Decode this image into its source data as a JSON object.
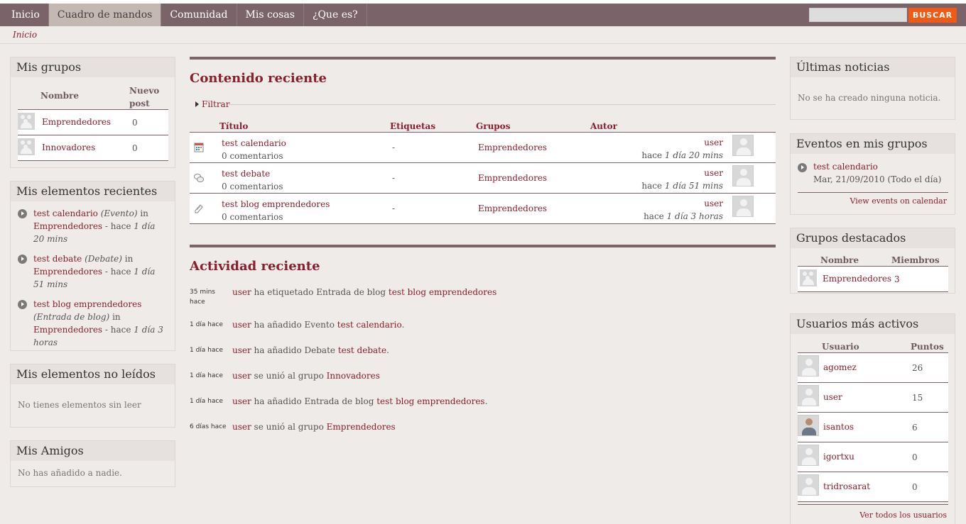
{
  "nav": {
    "tabs": [
      "Inicio",
      "Cuadro de mandos",
      "Comunidad",
      "Mis cosas",
      "¿Que es?"
    ],
    "active_index": 1,
    "search_placeholder": "",
    "search_button": "BUSCAR"
  },
  "breadcrumb": "Inicio",
  "left": {
    "groups": {
      "title": "Mis grupos",
      "col_name": "Nombre",
      "col_new": "Nuevo post",
      "rows": [
        {
          "name": "Emprendedores",
          "count": "0"
        },
        {
          "name": "Innovadores",
          "count": "0"
        }
      ]
    },
    "recent": {
      "title": "Mis elementos recientes",
      "items": [
        {
          "title": "test calendario",
          "type": "(Evento)",
          "in": " in ",
          "group": "Emprendedores",
          "sep": " - hace ",
          "time": "1 día 20 mins"
        },
        {
          "title": "test debate",
          "type": "(Debate)",
          "in": " in ",
          "group": "Emprendedores",
          "sep": " - hace ",
          "time": "1 día 51 mins"
        },
        {
          "title": "test blog emprendedores",
          "type": "(Entrada de blog)",
          "in": " in ",
          "group": "Emprendedores",
          "sep": " - hace ",
          "time": "1 día 3 horas"
        }
      ]
    },
    "unread": {
      "title": "Mis elementos no leídos",
      "text": "No tienes elementos sin leer"
    },
    "friends": {
      "title": "Mis Amigos",
      "text": "No has añadido a nadie."
    }
  },
  "content": {
    "title": "Contenido reciente",
    "filter": "Filtrar",
    "headers": {
      "title": "Título",
      "tags": "Etiquetas",
      "groups": "Grupos",
      "author": "Autor"
    },
    "rows": [
      {
        "icon": "calendar-icon",
        "title": "test calendario",
        "comments": "0 comentarios",
        "tags": "-",
        "group": "Emprendedores",
        "author": "user",
        "time_prefix": "hace ",
        "time": "1 día 20 mins"
      },
      {
        "icon": "debate-icon",
        "title": "test debate",
        "comments": "0 comentarios",
        "tags": "-",
        "group": "Emprendedores",
        "author": "user",
        "time_prefix": "hace ",
        "time": "1 día 51 mins"
      },
      {
        "icon": "blog-icon",
        "title": "test blog emprendedores",
        "comments": "0 comentarios",
        "tags": "-",
        "group": "Emprendedores",
        "author": "user",
        "time_prefix": "hace ",
        "time": "1 día 3 horas"
      }
    ]
  },
  "activity": {
    "title": "Actividad reciente",
    "rows": [
      {
        "time": "35 mins hace",
        "user": "user",
        "action": " ha etiquetado Entrada de blog ",
        "target": "test blog emprendedores",
        "end": ""
      },
      {
        "time": "1 día hace",
        "user": "user",
        "action": " ha añadido Evento ",
        "target": "test calendario",
        "end": "."
      },
      {
        "time": "1 día hace",
        "user": "user",
        "action": " ha añadido Debate ",
        "target": "test debate",
        "end": "."
      },
      {
        "time": "1 día hace",
        "user": "user",
        "action": " se unió al grupo ",
        "target": "Innovadores",
        "end": ""
      },
      {
        "time": "1 día hace",
        "user": "user",
        "action": " ha añadido Entrada de blog ",
        "target": "test blog emprendedores",
        "end": "."
      },
      {
        "time": "6 días hace",
        "user": "user",
        "action": " se unió al grupo ",
        "target": "Emprendedores",
        "end": ""
      }
    ]
  },
  "right": {
    "news": {
      "title": "Últimas noticias",
      "text": "No se ha creado ninguna noticia."
    },
    "events": {
      "title": "Eventos en mis grupos",
      "item_title": "test calendario",
      "item_date": "Mar, 21/09/2010 (Todo el día)",
      "link": "View events on calendar"
    },
    "featured": {
      "title": "Grupos destacados",
      "col_name": "Nombre",
      "col_members": "Miembros",
      "rows": [
        {
          "name": "Emprendedores",
          "members": "3"
        }
      ]
    },
    "active_users": {
      "title": "Usuarios más activos",
      "col_user": "Usuario",
      "col_points": "Puntos",
      "rows": [
        {
          "name": "agomez",
          "points": "26",
          "photo": false
        },
        {
          "name": "user",
          "points": "15",
          "photo": false
        },
        {
          "name": "isantos",
          "points": "6",
          "photo": true
        },
        {
          "name": "igortxu",
          "points": "0",
          "photo": false
        },
        {
          "name": "tridrosarat",
          "points": "0",
          "photo": false
        }
      ],
      "link": "Ver todos los usuarios"
    }
  }
}
